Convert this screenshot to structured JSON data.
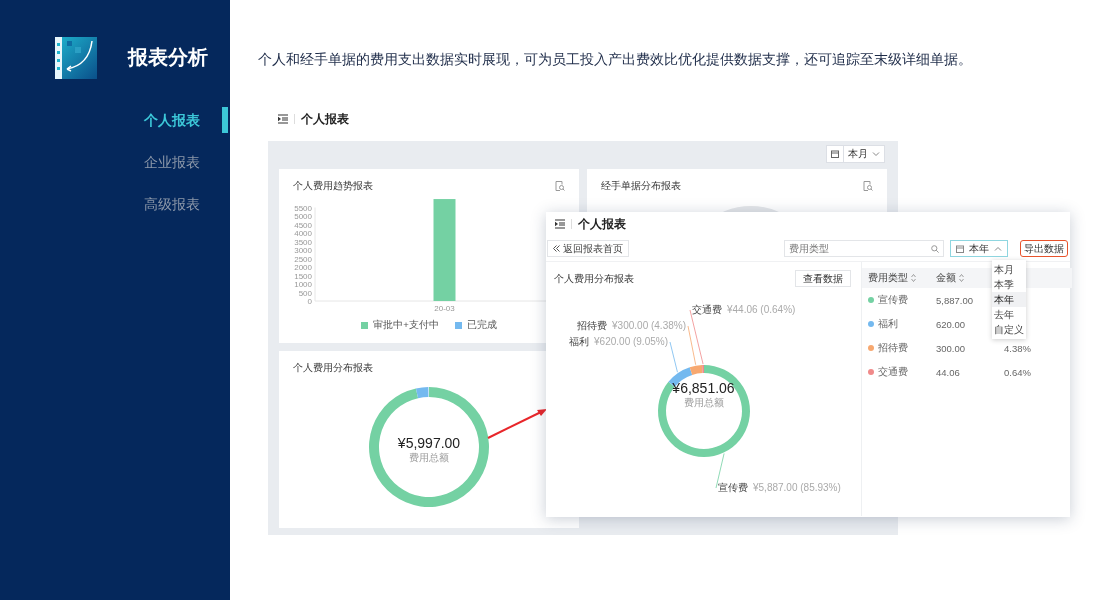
{
  "sidebar": {
    "title": "报表分析",
    "items": [
      {
        "label": "个人报表",
        "selected": true
      },
      {
        "label": "企业报表",
        "selected": false
      },
      {
        "label": "高级报表",
        "selected": false
      }
    ]
  },
  "description": "个人和经手单据的费用支出数据实时展现，可为员工投入产出费效比优化提供数据支撑，还可追踪至末级详细单据。",
  "dashboard": {
    "title": "个人报表",
    "period": "本月",
    "cards": [
      {
        "kind": "bar",
        "title": "个人费用趋势报表",
        "chart_data": {
          "type": "bar",
          "categories": [
            "20-03"
          ],
          "series": [
            {
              "name": "审批中+支付中",
              "color": "#74d1a3",
              "values": [
                5997
              ]
            },
            {
              "name": "已完成",
              "color": "#74b9ef",
              "values": [
                0
              ]
            }
          ],
          "ylim": [
            0,
            6000
          ],
          "yticks": [
            0,
            500,
            1000,
            1500,
            2000,
            2500,
            3000,
            3500,
            4000,
            4500,
            5000,
            5500
          ],
          "stacked": true
        }
      },
      {
        "kind": "ring",
        "title": "经手单据分布报表"
      },
      {
        "kind": "donut",
        "title": "个人费用分布报表",
        "total": "¥5,997.00",
        "total_label": "费用总额"
      }
    ]
  },
  "detail_window": {
    "title": "个人报表",
    "back_button": "返回报表首页",
    "filter": {
      "placeholder": "费用类型"
    },
    "period": "本年",
    "export_button": "导出数据",
    "period_menu": [
      {
        "label": "本月",
        "selected": false
      },
      {
        "label": "本季",
        "selected": false
      },
      {
        "label": "本年",
        "selected": true
      },
      {
        "label": "去年",
        "selected": false
      },
      {
        "label": "自定义",
        "selected": false
      }
    ],
    "panel_title": "个人费用分布报表",
    "view_button": "查看数据",
    "total": "¥6,851.06",
    "total_label": "费用总额",
    "chart_data": {
      "type": "donut",
      "categories": [
        "宣传费",
        "福利",
        "招待费",
        "交通费"
      ],
      "values": [
        5887,
        620,
        300,
        44.06
      ],
      "colors": [
        "#74d1a3",
        "#74b9ef",
        "#f7a870",
        "#f08a8a"
      ],
      "value_labels": [
        "¥5,887.00 (85.93%)",
        "¥620.00 (9.05%)",
        "¥300.00 (4.38%)",
        "¥44.06 (0.64%)"
      ]
    },
    "table": {
      "columns": [
        "费用类型",
        "金额"
      ],
      "rows": [
        {
          "name": "宣传费",
          "color": "#74d1a3",
          "amount": "5,887.00"
        },
        {
          "name": "福利",
          "color": "#74b9ef",
          "amount": "620.00"
        },
        {
          "name": "招待费",
          "color": "#f7a870",
          "amount": "300.00",
          "percent": "4.38%"
        },
        {
          "name": "交通费",
          "color": "#f08a8a",
          "amount": "44.06",
          "percent": "0.64%"
        }
      ]
    }
  }
}
